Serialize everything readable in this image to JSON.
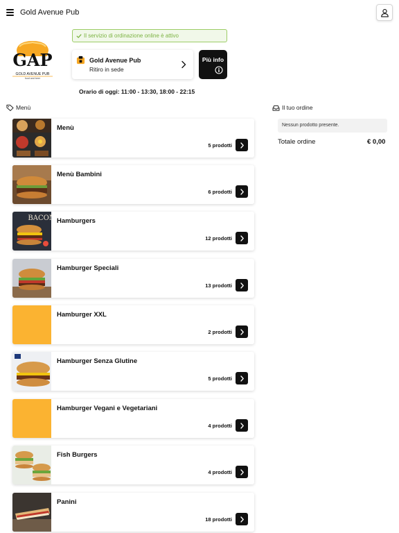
{
  "header": {
    "title": "Gold Avenue Pub",
    "menu_icon": "hamburger-menu-icon",
    "user_icon": "user-icon"
  },
  "logo": {
    "text": "GAP",
    "tagline": "GOLD AVENUE PUB",
    "subtagline": "food and beer"
  },
  "banner": {
    "text": "Il servizio di ordinazione online è attivo",
    "icon": "check-icon",
    "color": "#7cb342"
  },
  "venue": {
    "name": "Gold Avenue Pub",
    "mode": "Ritiro in sede",
    "icon": "store-icon"
  },
  "info_button": {
    "label": "Più info",
    "icon": "info-circle-icon"
  },
  "hours": "Orario di oggi: 11:00 - 13:30, 18:00 - 22:15",
  "menu_section": {
    "title": "Menù",
    "icon": "tag-icon"
  },
  "categories": [
    {
      "name": "Menù",
      "count": "5 prodotti",
      "thumb": "photo"
    },
    {
      "name": "Menù Bambini",
      "count": "6 prodotti",
      "thumb": "photo"
    },
    {
      "name": "Hamburgers",
      "count": "12 prodotti",
      "thumb": "photo"
    },
    {
      "name": "Hamburger Speciali",
      "count": "13 prodotti",
      "thumb": "photo"
    },
    {
      "name": "Hamburger XXL",
      "count": "2 prodotti",
      "thumb": "placeholder"
    },
    {
      "name": "Hamburger Senza Glutine",
      "count": "5 prodotti",
      "thumb": "photo"
    },
    {
      "name": "Hamburger Vegani e Vegetariani",
      "count": "4 prodotti",
      "thumb": "placeholder"
    },
    {
      "name": "Fish Burgers",
      "count": "4 prodotti",
      "thumb": "photo"
    },
    {
      "name": "Panini",
      "count": "18 prodotti",
      "thumb": "photo"
    }
  ],
  "order": {
    "title": "Il tuo ordine",
    "icon": "inbox-icon",
    "empty_text": "Nessun prodotto presente.",
    "total_label": "Totale ordine",
    "total_value": "€ 0,00"
  },
  "colors": {
    "placeholder": "#fbb331",
    "accent": "#111111",
    "success": "#7cb342"
  }
}
